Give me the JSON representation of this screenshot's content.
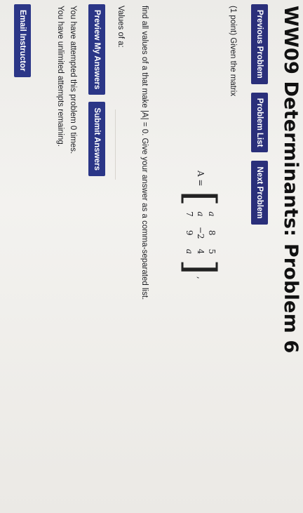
{
  "header": {
    "title": "WW09 Determinants: Problem 6"
  },
  "nav": {
    "prev_label": "Previous Problem",
    "list_label": "Problem List",
    "next_label": "Next Problem"
  },
  "problem": {
    "intro": "(1 point) Given the matrix",
    "matrix_label": "A =",
    "matrix_rows": [
      [
        "a",
        "8",
        "5"
      ],
      [
        "a",
        "−2",
        "4"
      ],
      [
        "7",
        "9",
        "a"
      ]
    ],
    "instruction": "find all values of a that make |A| = 0. Give your answer as a comma-separated list.",
    "values_label": "Values of a:",
    "answer_value": ""
  },
  "actions": {
    "preview_label": "Preview My Answers",
    "submit_label": "Submit Answers"
  },
  "status": {
    "attempts": "You have attempted this problem 0 times.",
    "remaining": "You have unlimited attempts remaining."
  },
  "footer": {
    "email_label": "Email Instructor"
  }
}
